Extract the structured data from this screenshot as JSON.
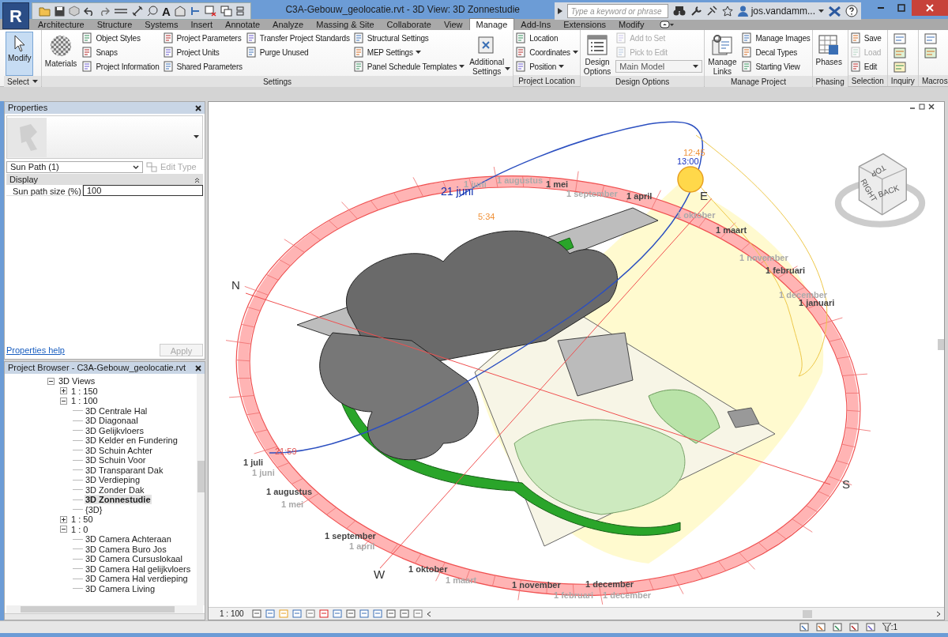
{
  "app_button": {
    "label": "R"
  },
  "quick_access": {
    "text_tool": "A"
  },
  "window": {
    "title": "C3A-Gebouw_geolocatie.rvt - 3D View: 3D Zonnestudie"
  },
  "search": {
    "placeholder": "Type a keyword or phrase"
  },
  "user": {
    "name": "jos.vandamm..."
  },
  "tabs": [
    {
      "label": "Architecture",
      "selected": false
    },
    {
      "label": "Structure",
      "selected": false
    },
    {
      "label": "Systems",
      "selected": false
    },
    {
      "label": "Insert",
      "selected": false
    },
    {
      "label": "Annotate",
      "selected": false
    },
    {
      "label": "Analyze",
      "selected": false
    },
    {
      "label": "Massing & Site",
      "selected": false
    },
    {
      "label": "Collaborate",
      "selected": false
    },
    {
      "label": "View",
      "selected": false
    },
    {
      "label": "Manage",
      "selected": true
    },
    {
      "label": "Add-Ins",
      "selected": false
    },
    {
      "label": "Extensions",
      "selected": false
    },
    {
      "label": "Modify",
      "selected": false
    }
  ],
  "ribbon_panels": [
    {
      "title": "Select",
      "dropdown": true,
      "groups": [
        {
          "kind": "large",
          "label": "Modify",
          "selected": true,
          "dropdown": false
        }
      ]
    },
    {
      "title": "Settings",
      "dropdown": false,
      "groups": [
        {
          "kind": "large",
          "label": "Materials",
          "selected": false,
          "dropdown": false
        },
        {
          "kind": "stack",
          "items": [
            {
              "label": "Object Styles",
              "disabled": false,
              "dropdown": false
            },
            {
              "label": "Snaps",
              "disabled": false,
              "dropdown": false
            },
            {
              "label": "Project Information",
              "disabled": false,
              "dropdown": false
            }
          ]
        },
        {
          "kind": "stack",
          "items": [
            {
              "label": "Project Parameters",
              "disabled": false,
              "dropdown": false
            },
            {
              "label": "Project Units",
              "disabled": false,
              "dropdown": false
            },
            {
              "label": "Shared Parameters",
              "disabled": false,
              "dropdown": false
            }
          ]
        },
        {
          "kind": "stack",
          "items": [
            {
              "label": "Transfer Project Standards",
              "disabled": false,
              "dropdown": false
            },
            {
              "label": "Purge Unused",
              "disabled": false,
              "dropdown": false
            }
          ]
        },
        {
          "kind": "stack",
          "items": [
            {
              "label": "Structural Settings",
              "disabled": false,
              "dropdown": false
            },
            {
              "label": "MEP Settings",
              "disabled": false,
              "dropdown": true
            },
            {
              "label": "Panel Schedule Templates",
              "disabled": false,
              "dropdown": true
            }
          ]
        },
        {
          "kind": "large",
          "label": "Additional Settings",
          "selected": false,
          "dropdown": true
        }
      ]
    },
    {
      "title": "Project Location",
      "dropdown": false,
      "groups": [
        {
          "kind": "stack",
          "items": [
            {
              "label": "Location",
              "disabled": false,
              "dropdown": false
            },
            {
              "label": "Coordinates",
              "disabled": false,
              "dropdown": true
            },
            {
              "label": "Position",
              "disabled": false,
              "dropdown": true
            }
          ]
        }
      ]
    },
    {
      "title": "Design Options",
      "dropdown": false,
      "groups": [
        {
          "kind": "large",
          "label": "Design Options",
          "selected": false,
          "dropdown": false
        },
        {
          "kind": "stack",
          "items": [
            {
              "label": "Add to Set",
              "disabled": true,
              "dropdown": false
            },
            {
              "label": "Pick to Edit",
              "disabled": true,
              "dropdown": false
            }
          ],
          "select": "Main Model"
        }
      ]
    },
    {
      "title": "Manage Project",
      "dropdown": false,
      "groups": [
        {
          "kind": "large",
          "label": "Manage Links",
          "selected": false,
          "dropdown": false
        },
        {
          "kind": "stack",
          "items": [
            {
              "label": "Manage Images",
              "disabled": false,
              "dropdown": false
            },
            {
              "label": "Decal Types",
              "disabled": false,
              "dropdown": false
            },
            {
              "label": "Starting View",
              "disabled": false,
              "dropdown": false
            }
          ]
        }
      ]
    },
    {
      "title": "Phasing",
      "dropdown": false,
      "groups": [
        {
          "kind": "large",
          "label": "Phases",
          "selected": false,
          "dropdown": false
        }
      ]
    },
    {
      "title": "Selection",
      "dropdown": false,
      "groups": [
        {
          "kind": "stack",
          "items": [
            {
              "label": "Save",
              "disabled": false,
              "dropdown": false
            },
            {
              "label": "Load",
              "disabled": true,
              "dropdown": false
            },
            {
              "label": "Edit",
              "disabled": false,
              "dropdown": false
            }
          ]
        }
      ]
    },
    {
      "title": "Inquiry",
      "dropdown": false,
      "groups": [
        {
          "kind": "icon_stack_3"
        }
      ]
    },
    {
      "title": "Macros",
      "dropdown": false,
      "groups": [
        {
          "kind": "icon_stack_2"
        }
      ]
    }
  ],
  "properties": {
    "title": "Properties",
    "type": "Sun Path (1)",
    "edit_type": {
      "label": "Edit Type",
      "disabled": true
    },
    "group": "Display",
    "rows": [
      {
        "name": "Sun path size (%)",
        "value": "100"
      }
    ],
    "help": "Properties help",
    "apply": {
      "label": "Apply",
      "disabled": true
    }
  },
  "project_browser": {
    "title": "Project Browser - C3A-Gebouw_geolocatie.rvt",
    "tree": [
      {
        "label": "3D Views",
        "expanded": true,
        "children": [
          {
            "label": "1 : 150",
            "expanded": false
          },
          {
            "label": "1 : 100",
            "expanded": true,
            "children": [
              {
                "label": "3D Centrale Hal",
                "selected": false
              },
              {
                "label": "3D Diagonaal",
                "selected": false
              },
              {
                "label": "3D Gelijkvloers",
                "selected": false
              },
              {
                "label": "3D Kelder en Fundering",
                "selected": false
              },
              {
                "label": "3D Schuin Achter",
                "selected": false
              },
              {
                "label": "3D Schuin Voor",
                "selected": false
              },
              {
                "label": "3D Transparant Dak",
                "selected": false
              },
              {
                "label": "3D Verdieping",
                "selected": false
              },
              {
                "label": "3D Zonder Dak",
                "selected": false
              },
              {
                "label": "3D Zonnestudie",
                "selected": true
              },
              {
                "label": "{3D}",
                "selected": false
              }
            ]
          },
          {
            "label": "1 : 50",
            "expanded": false
          },
          {
            "label": "1 : 0",
            "expanded": true,
            "children": [
              {
                "label": "3D Camera Achteraan",
                "selected": false
              },
              {
                "label": "3D Camera Buro Jos",
                "selected": false
              },
              {
                "label": "3D Camera Cursuslokaal",
                "selected": false
              },
              {
                "label": "3D Camera Hal gelijkvloers",
                "selected": false
              },
              {
                "label": "3D Camera Hal verdieping",
                "selected": false
              },
              {
                "label": "3D Camera Living",
                "selected": false
              }
            ]
          }
        ]
      }
    ]
  },
  "view": {
    "cube_faces": [
      "TOP",
      "BACK",
      "RIGHT"
    ],
    "labels": [
      {
        "text": "21 juni",
        "kind": "solstice"
      },
      {
        "text": "1 juni",
        "kind": "faded"
      },
      {
        "text": "1 augustus",
        "kind": "faded"
      },
      {
        "text": "1 mei",
        "kind": "date"
      },
      {
        "text": "1 september",
        "kind": "faded"
      },
      {
        "text": "1 april",
        "kind": "date"
      },
      {
        "text": "5:34",
        "kind": "time_orange"
      },
      {
        "text": "12:45",
        "kind": "time_orange"
      },
      {
        "text": "13:00",
        "kind": "time_blue"
      },
      {
        "text": "E",
        "kind": "compass"
      },
      {
        "text": "1 oktober",
        "kind": "faded"
      },
      {
        "text": "1 maart",
        "kind": "date"
      },
      {
        "text": "1 november",
        "kind": "faded"
      },
      {
        "text": "1 februari",
        "kind": "date"
      },
      {
        "text": "1 december",
        "kind": "faded"
      },
      {
        "text": "1 januari",
        "kind": "date"
      },
      {
        "text": "N",
        "kind": "compass"
      },
      {
        "text": "21:59",
        "kind": "time_red"
      },
      {
        "text": "1 juli",
        "kind": "date"
      },
      {
        "text": "1 juni",
        "kind": "faded"
      },
      {
        "text": "1 augustus",
        "kind": "date"
      },
      {
        "text": "1 mei",
        "kind": "faded"
      },
      {
        "text": "1 september",
        "kind": "date"
      },
      {
        "text": "1 april",
        "kind": "faded"
      },
      {
        "text": "W",
        "kind": "compass"
      },
      {
        "text": "1 oktober",
        "kind": "date"
      },
      {
        "text": "1 maart",
        "kind": "faded"
      },
      {
        "text": "1 november",
        "kind": "date"
      },
      {
        "text": "1 februari",
        "kind": "faded"
      },
      {
        "text": "1 december",
        "kind": "date"
      },
      {
        "text": "1 december",
        "kind": "faded"
      },
      {
        "text": "S",
        "kind": "compass"
      }
    ],
    "scale": "1 : 100"
  },
  "status_bar": {
    "filter_count": ":1"
  }
}
